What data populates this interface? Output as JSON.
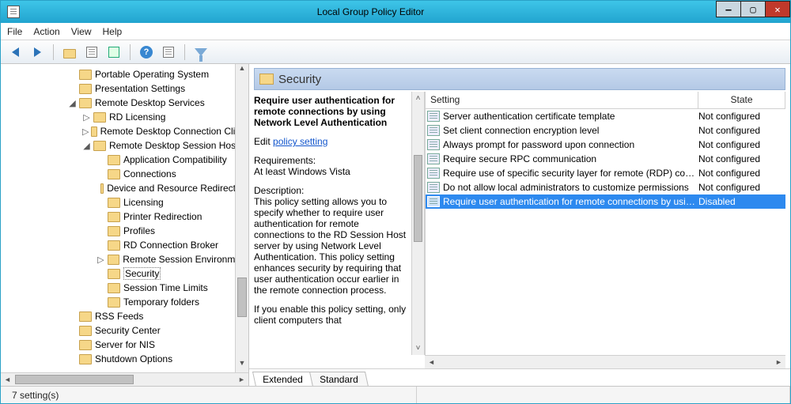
{
  "window": {
    "title": "Local Group Policy Editor"
  },
  "menubar": {
    "file": "File",
    "action": "Action",
    "view": "View",
    "help": "Help"
  },
  "category": {
    "title": "Security"
  },
  "ext": {
    "title": "Require user authentication for remote connections by using Network Level Authentication",
    "edit_prefix": "Edit ",
    "edit_link": "policy setting",
    "req_label": "Requirements:",
    "req_value": "At least Windows Vista",
    "desc_label": "Description:",
    "desc_text": "This policy setting allows you to specify whether to require user authentication for remote connections to the RD Session Host server by using Network Level Authentication. This policy setting enhances security by requiring that user authentication occur earlier in the remote connection process.",
    "desc_more": "If you enable this policy setting, only client computers that"
  },
  "columns": {
    "setting": "Setting",
    "state": "State"
  },
  "settings": [
    {
      "name": "Server authentication certificate template",
      "state": "Not configured"
    },
    {
      "name": "Set client connection encryption level",
      "state": "Not configured"
    },
    {
      "name": "Always prompt for password upon connection",
      "state": "Not configured"
    },
    {
      "name": "Require secure RPC communication",
      "state": "Not configured"
    },
    {
      "name": "Require use of specific security layer for remote (RDP) conn...",
      "state": "Not configured"
    },
    {
      "name": "Do not allow local administrators to customize permissions",
      "state": "Not configured"
    },
    {
      "name": "Require user authentication for remote connections by usin...",
      "state": "Disabled"
    }
  ],
  "tree": [
    {
      "indent": 85,
      "exp": "",
      "label": "Portable Operating System"
    },
    {
      "indent": 85,
      "exp": "",
      "label": "Presentation Settings"
    },
    {
      "indent": 85,
      "exp": "open",
      "label": "Remote Desktop Services"
    },
    {
      "indent": 103,
      "exp": "closed",
      "label": "RD Licensing"
    },
    {
      "indent": 103,
      "exp": "closed",
      "label": "Remote Desktop Connection Client"
    },
    {
      "indent": 103,
      "exp": "open",
      "label": "Remote Desktop Session Host"
    },
    {
      "indent": 121,
      "exp": "",
      "label": "Application Compatibility"
    },
    {
      "indent": 121,
      "exp": "",
      "label": "Connections"
    },
    {
      "indent": 121,
      "exp": "",
      "label": "Device and Resource Redirection"
    },
    {
      "indent": 121,
      "exp": "",
      "label": "Licensing"
    },
    {
      "indent": 121,
      "exp": "",
      "label": "Printer Redirection"
    },
    {
      "indent": 121,
      "exp": "",
      "label": "Profiles"
    },
    {
      "indent": 121,
      "exp": "",
      "label": "RD Connection Broker"
    },
    {
      "indent": 121,
      "exp": "closed",
      "label": "Remote Session Environment"
    },
    {
      "indent": 121,
      "exp": "",
      "label": "Security",
      "sel": true
    },
    {
      "indent": 121,
      "exp": "",
      "label": "Session Time Limits"
    },
    {
      "indent": 121,
      "exp": "",
      "label": "Temporary folders"
    },
    {
      "indent": 85,
      "exp": "",
      "label": "RSS Feeds"
    },
    {
      "indent": 85,
      "exp": "",
      "label": "Security Center"
    },
    {
      "indent": 85,
      "exp": "",
      "label": "Server for NIS"
    },
    {
      "indent": 85,
      "exp": "",
      "label": "Shutdown Options"
    }
  ],
  "tabs": {
    "extended": "Extended",
    "standard": "Standard"
  },
  "status": {
    "count": "7 setting(s)"
  }
}
